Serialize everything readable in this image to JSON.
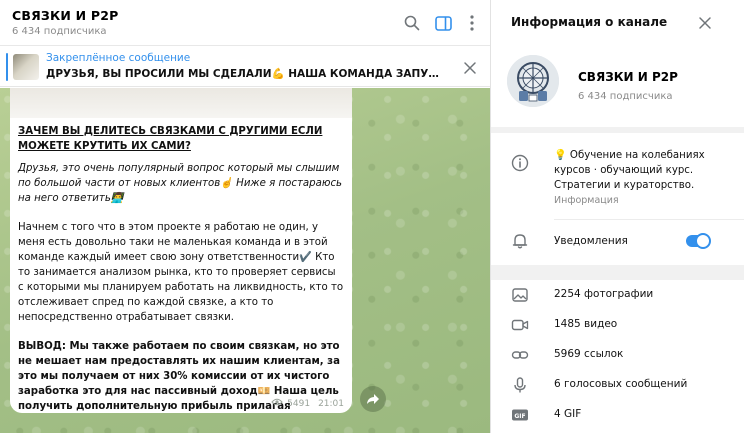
{
  "chat": {
    "title": "СВЯЗКИ И P2P",
    "subscribers": "6 434 подписчика",
    "pinned": {
      "label": "Закреплённое сообщение",
      "text": "ДРУЗЬЯ, ВЫ ПРОСИЛИ МЫ СДЕЛАЛИ💪 НАША КОМАНДА ЗАПУСКАЕТ ЧАТ Д..."
    },
    "message": {
      "heading": "ЗАЧЕМ ВЫ ДЕЛИТЕСЬ СВЯЗКАМИ С ДРУГИМИ ЕСЛИ МОЖЕТЕ КРУТИТЬ ИХ САМИ?",
      "intro": "Друзья, это очень популярный вопрос который мы слышим по большой части от новых клиентов☝️ Ниже я постараюсь на него ответить👨‍💻",
      "paragraph": "Начнем с того что в этом проекте я работаю не один, у меня есть довольно таки не маленькая команда и в этой команде каждый имеет свою зону ответственности✔️ Кто то занимается анализом рынка, кто то проверяет сервисы с которыми мы планируем работать на ликвидность, кто то отслеживает спред по каждой связке, а кто то непосредственно отрабатывает связки.",
      "conclusion": "ВЫВОД: Мы также работаем по своим связкам, но это не мешает нам предоставлять их нашим клиентам, за это мы получаем от них 30% комиссии от их чистого заработка это для нас пассивный доход💴 Наша цель получить дополнительную прибыль прилагая минимум усилий",
      "views": "5491",
      "time": "21:01"
    }
  },
  "info": {
    "title": "Информация о канале",
    "channel_name": "СВЯЗКИ И P2P",
    "subscribers": "6 434 подписчика",
    "description": "💡 Обучение на колебаниях курсов · обучающий курс. Стратегии и кураторство.",
    "description_label": "Информация",
    "notifications_label": "Уведомления",
    "notifications_on": true,
    "media": [
      {
        "icon": "photo-icon",
        "label": "2254 фотографии"
      },
      {
        "icon": "video-icon",
        "label": "1485 видео"
      },
      {
        "icon": "link-icon",
        "label": "5969 ссылок"
      },
      {
        "icon": "microphone-icon",
        "label": "6 голосовых сообщений"
      },
      {
        "icon": "gif-icon",
        "label": "4 GIF"
      }
    ]
  },
  "colors": {
    "accent": "#3390ec",
    "chat_background": "#a9c38a",
    "panel_background": "#f1f1f1"
  }
}
